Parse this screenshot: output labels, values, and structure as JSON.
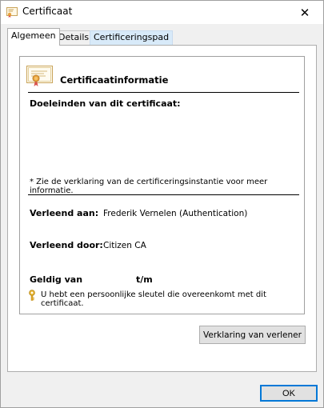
{
  "window": {
    "title": "Certificaat",
    "close_glyph": "✕"
  },
  "tabs": [
    {
      "label": "Algemeen",
      "active": true
    },
    {
      "label": "Details",
      "active": false
    },
    {
      "label": "Certificeringspad",
      "active": false
    }
  ],
  "certificate": {
    "heading": "Certificaatinformatie",
    "purposes_label": "Doeleinden van dit certificaat:",
    "note": "* Zie de verklaring van de certificeringsinstantie voor meer informatie.",
    "issued_to_label": "Verleend aan:",
    "issued_to_value": "Frederik Vernelen (Authentication)",
    "issued_by_label": "Verleend door:",
    "issued_by_value": "Citizen CA",
    "valid_from_label": "Geldig van",
    "valid_to_label": "t/m",
    "private_key_note": "U hebt een persoonlijke sleutel die overeenkomt met dit certificaat."
  },
  "buttons": {
    "issuer_statement": "Verklaring van verlener",
    "ok": "OK"
  },
  "colors": {
    "accent": "#0078d7",
    "seal": "#e8a33d",
    "ribbon": "#d9534f"
  },
  "icons": {
    "title": "certificate-icon",
    "close": "close-icon",
    "heading": "certificate-icon",
    "key": "key-icon"
  }
}
